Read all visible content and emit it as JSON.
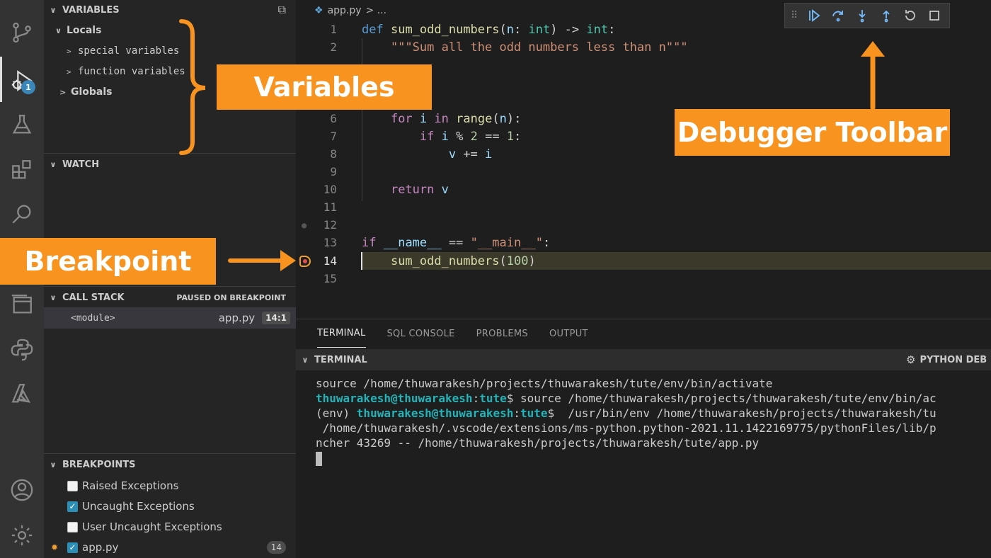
{
  "activity_bar": {
    "icons": [
      "source-control-icon",
      "run-debug-icon",
      "testing-icon",
      "extensions-icon",
      "search-icon",
      "remote-explorer-icon",
      "python-icon",
      "azure-icon",
      "account-icon",
      "gear-icon"
    ],
    "debug_badge": "1"
  },
  "sidebar": {
    "variables": {
      "title": "VARIABLES",
      "locals": "Locals",
      "special": "special variables",
      "function": "function variables",
      "globals": "Globals"
    },
    "watch": {
      "title": "WATCH"
    },
    "call_stack": {
      "title": "CALL STACK",
      "status": "PAUSED ON BREAKPOINT",
      "frames": [
        {
          "name": "<module>",
          "file": "app.py",
          "position": "14:1"
        }
      ]
    },
    "breakpoints": {
      "title": "BREAKPOINTS",
      "items": [
        {
          "label": "Raised Exceptions",
          "checked": false
        },
        {
          "label": "Uncaught Exceptions",
          "checked": true
        },
        {
          "label": "User Uncaught Exceptions",
          "checked": false
        },
        {
          "label": "app.py",
          "checked": true,
          "count": "14"
        }
      ]
    }
  },
  "editor": {
    "breadcrumb_file": "app.py",
    "breadcrumb_rest": "> ...",
    "line_numbers": [
      "1",
      "2",
      "6",
      "7",
      "8",
      "9",
      "10",
      "11",
      "12",
      "13",
      "14",
      "15"
    ]
  },
  "panel": {
    "tabs": [
      "TERMINAL",
      "SQL CONSOLE",
      "PROBLEMS",
      "OUTPUT"
    ],
    "terminal_title": "TERMINAL",
    "terminal_session": "PYTHON DEB",
    "lines": {
      "l1": "source /home/thuwarakesh/projects/thuwarakesh/tute/env/bin/activate",
      "l2_user": "thuwarakesh@thuwarakesh",
      "l2_sep": ":",
      "l2_dir": "tute",
      "l2_cmd": "$ source /home/thuwarakesh/projects/thuwarakesh/tute/env/bin/ac",
      "l3_env": "(env) ",
      "l3_user": "thuwarakesh@thuwarakesh",
      "l3_sep": ":",
      "l3_dir": "tute",
      "l3_cmd": "$  /usr/bin/env /home/thuwarakesh/projects/thuwarakesh/tu",
      "l4": " /home/thuwarakesh/.vscode/extensions/ms-python.python-2021.11.1422169775/pythonFiles/lib/p",
      "l5": "ncher 43269 -- /home/thuwarakesh/projects/thuwarakesh/tute/app.py"
    }
  },
  "annotations": {
    "variables": "Variables",
    "debugger_toolbar": "Debugger Toolbar",
    "breakpoint": "Breakpoint"
  },
  "colors": {
    "callout": "#f7931e",
    "keyword": "#569cd6",
    "function": "#dcdcaa",
    "terminal_user": "#23b3b8"
  }
}
